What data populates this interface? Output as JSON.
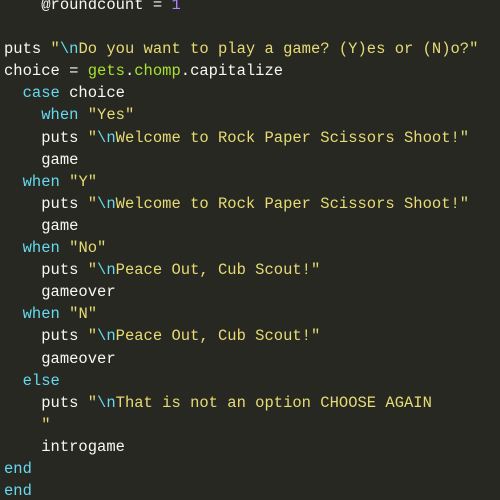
{
  "editor": {
    "theme": "monokai",
    "colors": {
      "background": "#272822",
      "default": "#f8f8f2",
      "keyword": "#66d9ef",
      "string": "#e6db74",
      "method": "#a6e22e",
      "escape": "#66d9ef",
      "number": "#ae81ff"
    },
    "lines": [
      {
        "indent": "    ",
        "tokens": [
          {
            "text": "@roundcount = ",
            "type": "ivar"
          },
          {
            "text": "1",
            "type": "number"
          }
        ]
      },
      {
        "indent": "",
        "tokens": []
      },
      {
        "indent": "",
        "tokens": [
          {
            "text": "puts ",
            "type": "default"
          },
          {
            "text": "\"",
            "type": "string"
          },
          {
            "text": "\\n",
            "type": "escape"
          },
          {
            "text": "Do you want to play a game? (Y)es or (N)o?\"",
            "type": "string"
          }
        ]
      },
      {
        "indent": "",
        "tokens": [
          {
            "text": "choice = ",
            "type": "default"
          },
          {
            "text": "gets",
            "type": "green"
          },
          {
            "text": ".",
            "type": "default"
          },
          {
            "text": "chomp",
            "type": "green"
          },
          {
            "text": ".capitalize",
            "type": "default"
          }
        ]
      },
      {
        "indent": "  ",
        "tokens": [
          {
            "text": "case",
            "type": "keyword"
          },
          {
            "text": " choice",
            "type": "default"
          }
        ]
      },
      {
        "indent": "    ",
        "tokens": [
          {
            "text": "when",
            "type": "keyword"
          },
          {
            "text": " ",
            "type": "default"
          },
          {
            "text": "\"Yes\"",
            "type": "string"
          }
        ]
      },
      {
        "indent": "    ",
        "tokens": [
          {
            "text": "puts ",
            "type": "default"
          },
          {
            "text": "\"",
            "type": "string"
          },
          {
            "text": "\\n",
            "type": "escape"
          },
          {
            "text": "Welcome to Rock Paper Scissors Shoot!\"",
            "type": "string"
          }
        ]
      },
      {
        "indent": "    ",
        "tokens": [
          {
            "text": "game",
            "type": "default"
          }
        ]
      },
      {
        "indent": "  ",
        "tokens": [
          {
            "text": "when",
            "type": "keyword"
          },
          {
            "text": " ",
            "type": "default"
          },
          {
            "text": "\"Y\"",
            "type": "string"
          }
        ]
      },
      {
        "indent": "    ",
        "tokens": [
          {
            "text": "puts ",
            "type": "default"
          },
          {
            "text": "\"",
            "type": "string"
          },
          {
            "text": "\\n",
            "type": "escape"
          },
          {
            "text": "Welcome to Rock Paper Scissors Shoot!\"",
            "type": "string"
          }
        ]
      },
      {
        "indent": "    ",
        "tokens": [
          {
            "text": "game",
            "type": "default"
          }
        ]
      },
      {
        "indent": "  ",
        "tokens": [
          {
            "text": "when",
            "type": "keyword"
          },
          {
            "text": " ",
            "type": "default"
          },
          {
            "text": "\"No\"",
            "type": "string"
          }
        ]
      },
      {
        "indent": "    ",
        "tokens": [
          {
            "text": "puts ",
            "type": "default"
          },
          {
            "text": "\"",
            "type": "string"
          },
          {
            "text": "\\n",
            "type": "escape"
          },
          {
            "text": "Peace Out, Cub Scout!\"",
            "type": "string"
          }
        ]
      },
      {
        "indent": "    ",
        "tokens": [
          {
            "text": "gameover",
            "type": "default"
          }
        ]
      },
      {
        "indent": "  ",
        "tokens": [
          {
            "text": "when",
            "type": "keyword"
          },
          {
            "text": " ",
            "type": "default"
          },
          {
            "text": "\"N\"",
            "type": "string"
          }
        ]
      },
      {
        "indent": "    ",
        "tokens": [
          {
            "text": "puts ",
            "type": "default"
          },
          {
            "text": "\"",
            "type": "string"
          },
          {
            "text": "\\n",
            "type": "escape"
          },
          {
            "text": "Peace Out, Cub Scout!\"",
            "type": "string"
          }
        ]
      },
      {
        "indent": "    ",
        "tokens": [
          {
            "text": "gameover",
            "type": "default"
          }
        ]
      },
      {
        "indent": "  ",
        "tokens": [
          {
            "text": "else",
            "type": "keyword"
          }
        ]
      },
      {
        "indent": "    ",
        "tokens": [
          {
            "text": "puts ",
            "type": "default"
          },
          {
            "text": "\"",
            "type": "string"
          },
          {
            "text": "\\n",
            "type": "escape"
          },
          {
            "text": "That is not an option CHOOSE AGAIN",
            "type": "string"
          }
        ]
      },
      {
        "indent": "    ",
        "tokens": [
          {
            "text": "\"",
            "type": "string"
          }
        ]
      },
      {
        "indent": "    ",
        "tokens": [
          {
            "text": "introgame",
            "type": "default"
          }
        ]
      },
      {
        "indent": "",
        "tokens": [
          {
            "text": "end",
            "type": "keyword"
          }
        ]
      },
      {
        "indent": "",
        "tokens": [
          {
            "text": "end",
            "type": "keyword"
          }
        ]
      }
    ]
  }
}
